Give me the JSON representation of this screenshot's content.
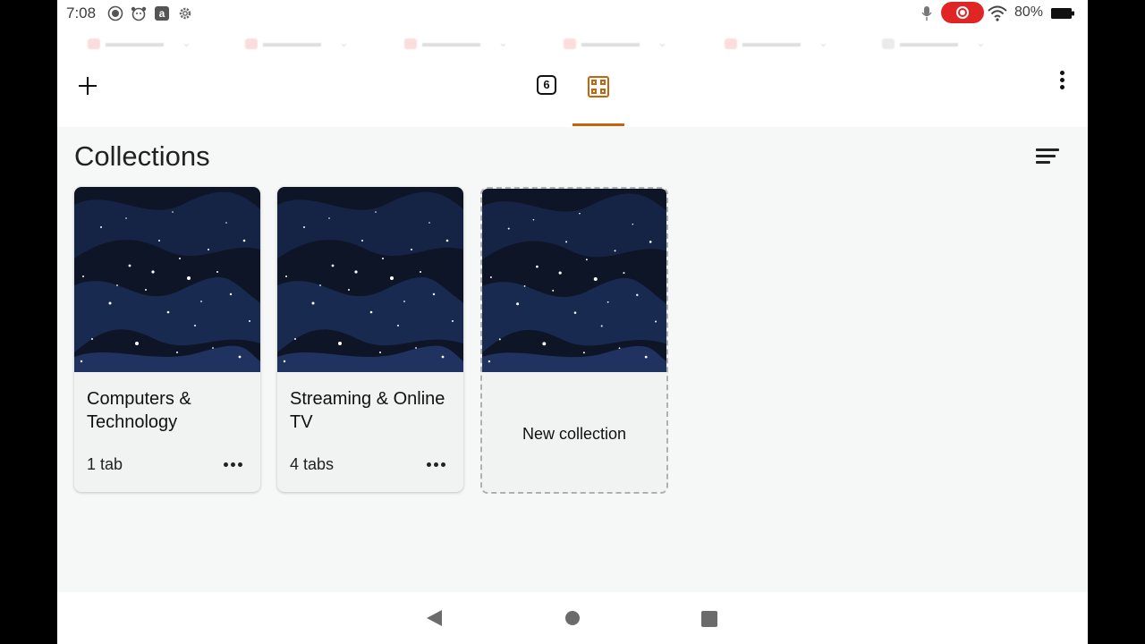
{
  "status_bar": {
    "time": "7:08",
    "battery": "80%",
    "icons": [
      "record-icon",
      "fire-kids-icon",
      "amazon-icon",
      "settings-icon",
      "mic-icon",
      "screen-record-icon",
      "wifi-icon",
      "battery-icon"
    ]
  },
  "toolbar": {
    "tab_count": "6",
    "active_tab": "collections",
    "accent_color": "#c9620f"
  },
  "page": {
    "title": "Collections"
  },
  "collections": [
    {
      "title": "Computers & Technology",
      "count": "1 tab"
    },
    {
      "title": "Streaming & Online TV",
      "count": "4 tabs"
    }
  ],
  "new_collection": {
    "label": "New collection"
  },
  "colors": {
    "card_background": "#f1f2f2",
    "page_background": "#f6f7f7",
    "thumbnail_night_sky": "#0f1a30"
  }
}
